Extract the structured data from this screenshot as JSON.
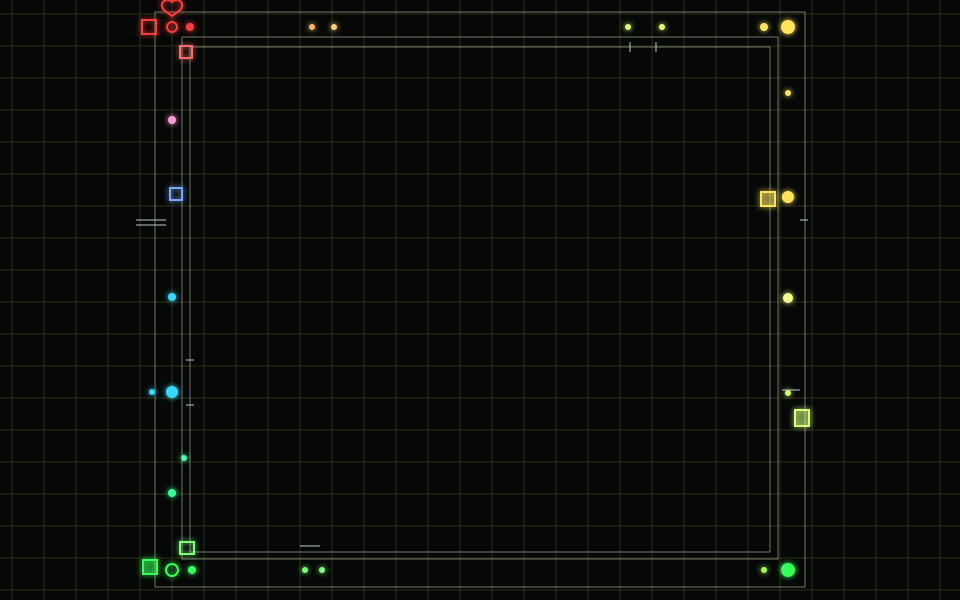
{
  "scene": {
    "description_visible_text": "",
    "colors": {
      "background": "#050806",
      "grid_major": "#5f6b24",
      "grid_minor": "#2a3012",
      "red": "#ff3b3b",
      "orange": "#ff8a3a",
      "yellow": "#ffe45a",
      "lime": "#a6ff4d",
      "green": "#34ff5a",
      "cyan": "#35d8ff",
      "blue": "#5a86ff",
      "inner_line": "#c9d7c0"
    },
    "icons": {
      "top_left_heart": "heart-icon",
      "corner_squares": "square-node-icon",
      "connectors": "circle-node-icon",
      "small_labels": "bracket-marker-icon"
    }
  }
}
